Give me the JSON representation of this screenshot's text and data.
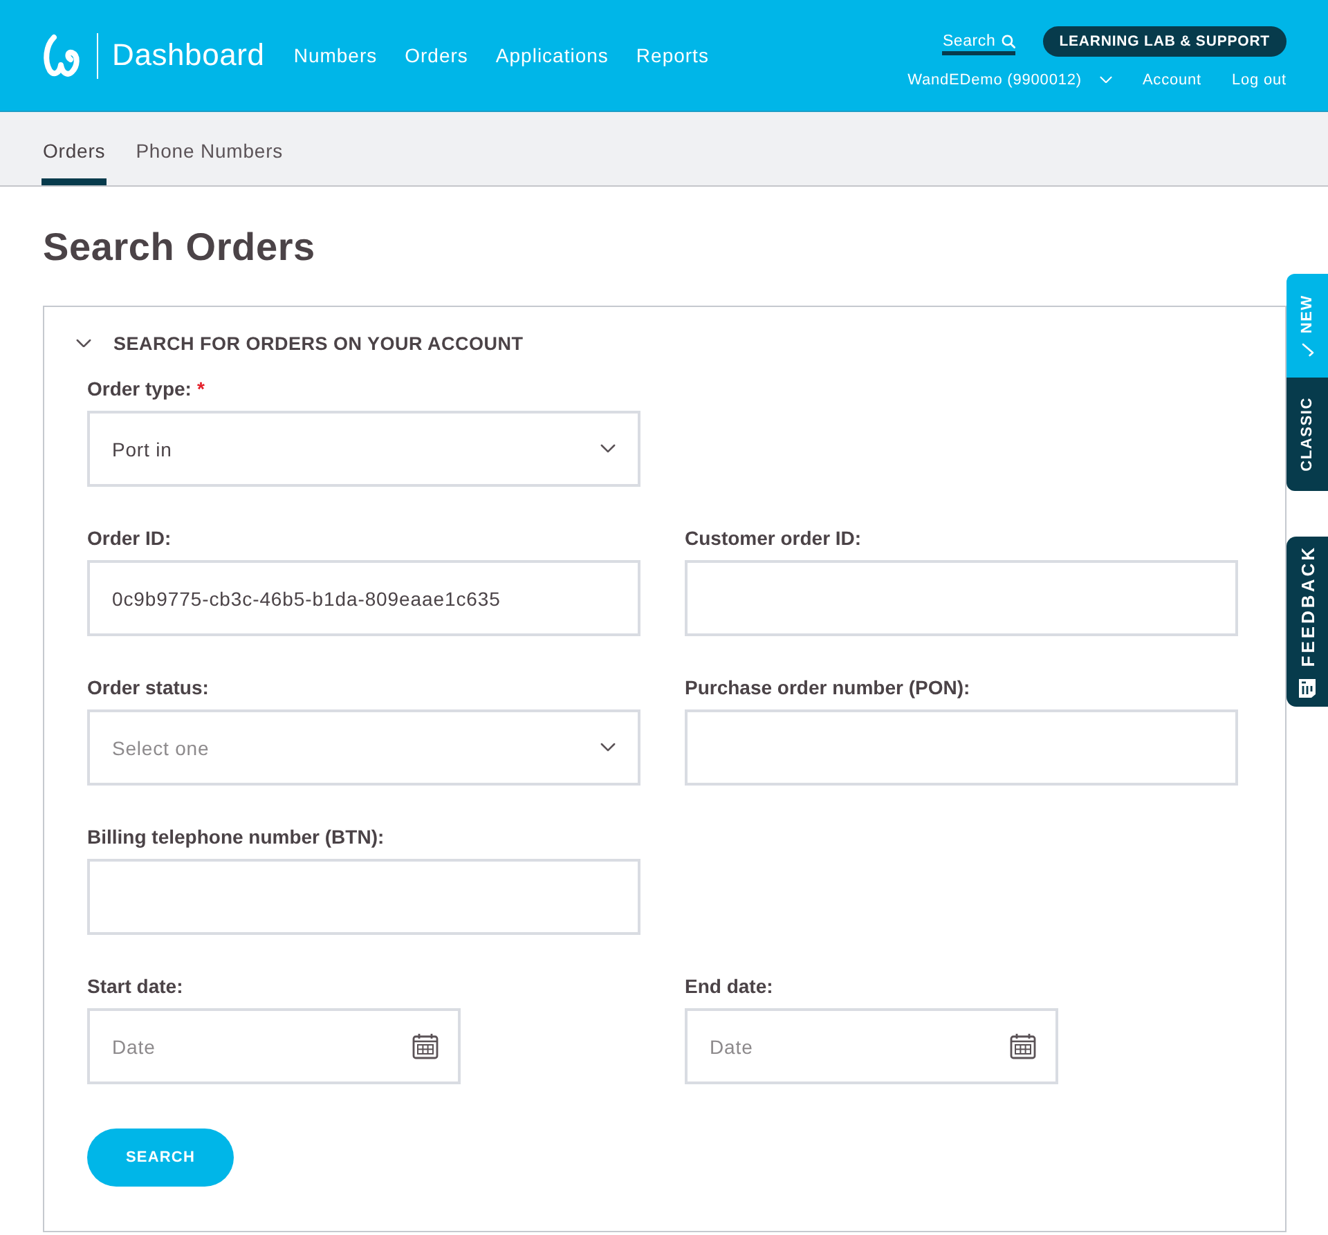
{
  "header": {
    "brand": {
      "title": "Dashboard"
    },
    "nav": [
      {
        "label": "Numbers"
      },
      {
        "label": "Orders"
      },
      {
        "label": "Applications"
      },
      {
        "label": "Reports"
      }
    ],
    "search_link": {
      "label": "Search",
      "active": true
    },
    "support_button": {
      "label": "LEARNING LAB & SUPPORT"
    },
    "account_switcher": {
      "label": "WandEDemo (9900012)"
    },
    "account_links": [
      {
        "label": "Account"
      },
      {
        "label": "Log out"
      }
    ]
  },
  "subnav": {
    "tabs": [
      {
        "label": "Orders",
        "selected": true
      },
      {
        "label": "Phone Numbers",
        "selected": false
      }
    ]
  },
  "page_title": "Search Orders",
  "search_panel": {
    "title": "SEARCH FOR ORDERS ON YOUR ACCOUNT",
    "expanded": true,
    "rows": [
      [
        {
          "kind": "select",
          "label": "Order type:",
          "required_mark": "*",
          "value": "Port in"
        }
      ],
      [
        {
          "kind": "text",
          "label": "Order ID:",
          "value": "0c9b9775-cb3c-46b5-b1da-809eaae1c635"
        },
        {
          "kind": "text",
          "label": "Customer order ID:"
        }
      ],
      [
        {
          "kind": "select",
          "label": "Order status:",
          "placeholder": "Select one"
        },
        {
          "kind": "text",
          "label": "Purchase order number (PON):"
        }
      ],
      [
        {
          "kind": "text",
          "label": "Billing telephone number (BTN):"
        }
      ],
      [
        {
          "kind": "date",
          "label": "Start date:",
          "placeholder": "Date"
        },
        {
          "kind": "date",
          "label": "End date:",
          "placeholder": "Date"
        }
      ]
    ],
    "submit_button": "SEARCH"
  },
  "view_switch": [
    {
      "label": "NEW",
      "selected": true
    },
    {
      "label": "CLASSIC",
      "selected": false
    }
  ],
  "feedback_tab": {
    "label": "FEEDBACK"
  }
}
